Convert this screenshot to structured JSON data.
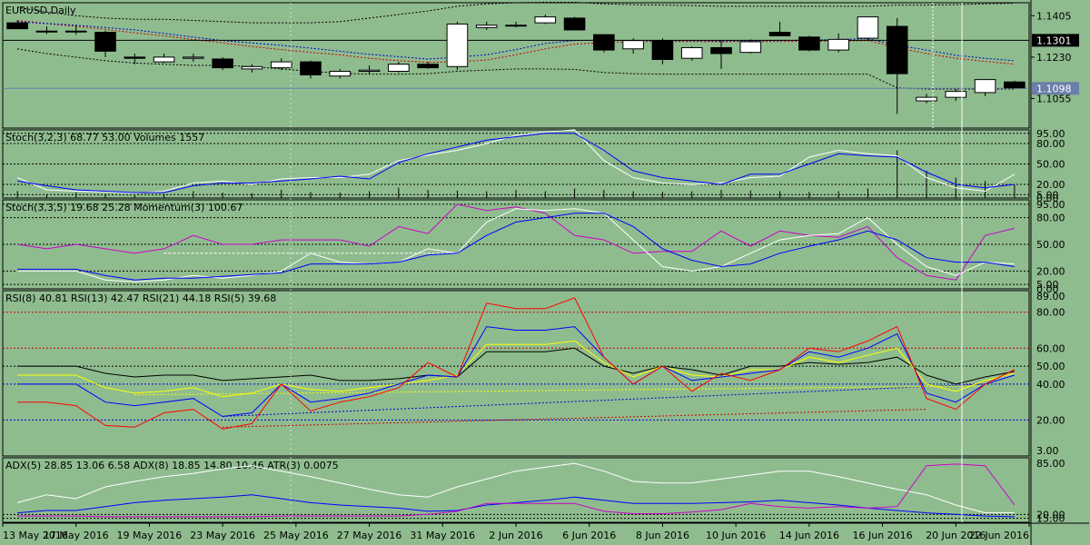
{
  "chart_data": [
    {
      "type": "candlestick",
      "title": "EURUSD,Daily",
      "price_labels": [
        "1.1405",
        "1.1230",
        "1.1055"
      ],
      "current_price": "1.1301",
      "bid_price": "1.1098",
      "ylim": [
        1.093,
        1.146
      ],
      "hline": 1.1301,
      "bidline": 1.1098,
      "candles": [
        {
          "o": 1.1375,
          "h": 1.1385,
          "l": 1.1355,
          "c": 1.135
        },
        {
          "o": 1.134,
          "h": 1.136,
          "l": 1.1328,
          "c": 1.134
        },
        {
          "o": 1.134,
          "h": 1.1365,
          "l": 1.1325,
          "c": 1.1338
        },
        {
          "o": 1.1335,
          "h": 1.1342,
          "l": 1.123,
          "c": 1.1255
        },
        {
          "o": 1.123,
          "h": 1.1245,
          "l": 1.12,
          "c": 1.1225
        },
        {
          "o": 1.121,
          "h": 1.1245,
          "l": 1.1205,
          "c": 1.123
        },
        {
          "o": 1.1225,
          "h": 1.1245,
          "l": 1.121,
          "c": 1.123
        },
        {
          "o": 1.1222,
          "h": 1.123,
          "l": 1.1175,
          "c": 1.1185
        },
        {
          "o": 1.118,
          "h": 1.12,
          "l": 1.1165,
          "c": 1.119
        },
        {
          "o": 1.1185,
          "h": 1.1225,
          "l": 1.1175,
          "c": 1.121
        },
        {
          "o": 1.121,
          "h": 1.1215,
          "l": 1.114,
          "c": 1.1155
        },
        {
          "o": 1.115,
          "h": 1.118,
          "l": 1.114,
          "c": 1.117
        },
        {
          "o": 1.117,
          "h": 1.1195,
          "l": 1.116,
          "c": 1.1175
        },
        {
          "o": 1.117,
          "h": 1.121,
          "l": 1.1165,
          "c": 1.12
        },
        {
          "o": 1.12,
          "h": 1.121,
          "l": 1.118,
          "c": 1.1185
        },
        {
          "o": 1.119,
          "h": 1.138,
          "l": 1.1175,
          "c": 1.137
        },
        {
          "o": 1.1355,
          "h": 1.138,
          "l": 1.1345,
          "c": 1.1365
        },
        {
          "o": 1.1365,
          "h": 1.138,
          "l": 1.1355,
          "c": 1.1365
        },
        {
          "o": 1.1375,
          "h": 1.141,
          "l": 1.137,
          "c": 1.14
        },
        {
          "o": 1.1395,
          "h": 1.14,
          "l": 1.1345,
          "c": 1.1345
        },
        {
          "o": 1.1325,
          "h": 1.1325,
          "l": 1.125,
          "c": 1.126
        },
        {
          "o": 1.1265,
          "h": 1.131,
          "l": 1.1245,
          "c": 1.13
        },
        {
          "o": 1.13,
          "h": 1.131,
          "l": 1.12,
          "c": 1.122
        },
        {
          "o": 1.1225,
          "h": 1.1275,
          "l": 1.1215,
          "c": 1.127
        },
        {
          "o": 1.127,
          "h": 1.13,
          "l": 1.118,
          "c": 1.1245
        },
        {
          "o": 1.125,
          "h": 1.1305,
          "l": 1.1245,
          "c": 1.1295
        },
        {
          "o": 1.1335,
          "h": 1.138,
          "l": 1.132,
          "c": 1.132
        },
        {
          "o": 1.1315,
          "h": 1.132,
          "l": 1.1255,
          "c": 1.126
        },
        {
          "o": 1.126,
          "h": 1.133,
          "l": 1.125,
          "c": 1.1305
        },
        {
          "o": 1.131,
          "h": 1.1395,
          "l": 1.13,
          "c": 1.14
        },
        {
          "o": 1.136,
          "h": 1.1395,
          "l": 1.099,
          "c": 1.116
        },
        {
          "o": 1.1045,
          "h": 1.1075,
          "l": 1.1035,
          "c": 1.106
        },
        {
          "o": 1.106,
          "h": 1.1095,
          "l": 1.1045,
          "c": 1.1085
        },
        {
          "o": 1.108,
          "h": 1.1135,
          "l": 1.1065,
          "c": 1.1135
        },
        {
          "o": 1.1125,
          "h": 1.113,
          "l": 1.11,
          "c": 1.11
        }
      ],
      "envelope_upper": [
        1.144,
        1.142,
        1.1405,
        1.1395,
        1.139,
        1.139,
        1.1385,
        1.138,
        1.1375,
        1.1375,
        1.1375,
        1.138,
        1.1395,
        1.141,
        1.1425,
        1.1445,
        1.1455,
        1.146,
        1.1462,
        1.1462,
        1.1455,
        1.1452,
        1.145,
        1.1448,
        1.1445,
        1.1445,
        1.1445,
        1.1445,
        1.1445,
        1.1445,
        1.145,
        1.145,
        1.1452,
        1.1455,
        1.1458
      ],
      "envelope_lower": [
        1.1265,
        1.1245,
        1.123,
        1.1215,
        1.1205,
        1.12,
        1.1195,
        1.1195,
        1.119,
        1.118,
        1.117,
        1.1162,
        1.1158,
        1.1158,
        1.116,
        1.117,
        1.1175,
        1.118,
        1.118,
        1.1178,
        1.1165,
        1.116,
        1.1158,
        1.1158,
        1.1158,
        1.1158,
        1.1158,
        1.1158,
        1.1158,
        1.1158,
        1.11,
        1.1095,
        1.1095,
        1.1095,
        1.1095
      ],
      "ma_fast": [
        1.138,
        1.1372,
        1.1365,
        1.1355,
        1.1345,
        1.133,
        1.1315,
        1.13,
        1.129,
        1.128,
        1.1268,
        1.1255,
        1.1242,
        1.1232,
        1.1222,
        1.123,
        1.124,
        1.1262,
        1.1288,
        1.13,
        1.1302,
        1.13,
        1.13,
        1.13,
        1.1298,
        1.13,
        1.13,
        1.1302,
        1.1305,
        1.1308,
        1.128,
        1.126,
        1.1238,
        1.1225,
        1.1215
      ],
      "ma_slow": [
        1.1385,
        1.1372,
        1.136,
        1.1347,
        1.1333,
        1.132,
        1.1305,
        1.129,
        1.1275,
        1.1262,
        1.125,
        1.124,
        1.1225,
        1.1215,
        1.1208,
        1.121,
        1.1218,
        1.124,
        1.1265,
        1.1285,
        1.1292,
        1.1295,
        1.1296,
        1.1296,
        1.1295,
        1.1296,
        1.1296,
        1.1297,
        1.1298,
        1.13,
        1.127,
        1.1245,
        1.1225,
        1.1212,
        1.12
      ],
      "colors": {
        "bull": "#ffffff",
        "bear": "#000000",
        "ma_fast": "#0000cc",
        "ma_slow": "#cc0000",
        "envelope": "#000000",
        "hline": "#000000",
        "bidline": "#6b7fa8"
      }
    },
    {
      "type": "line",
      "title": "Stoch(3,2,3) 68.77 53.00 Volumes 1557",
      "ylabels": [
        "95.00",
        "80.00",
        "50.00",
        "20.00",
        "5.00",
        "0.00"
      ],
      "ylim": [
        0,
        100
      ],
      "levels": [
        95,
        80,
        50,
        20,
        5
      ],
      "series": [
        {
          "color": "#ffffff",
          "values": [
            30,
            12,
            10,
            9,
            7,
            10,
            22,
            25,
            20,
            28,
            30,
            30,
            35,
            55,
            63,
            70,
            80,
            92,
            97,
            100,
            55,
            30,
            22,
            20,
            22,
            30,
            32,
            60,
            70,
            65,
            62,
            30,
            15,
            10,
            35,
            70
          ]
        },
        {
          "color": "#0000ff",
          "values": [
            25,
            18,
            12,
            10,
            8,
            8,
            18,
            22,
            22,
            25,
            28,
            32,
            28,
            52,
            65,
            75,
            85,
            90,
            95,
            95,
            70,
            40,
            30,
            25,
            20,
            35,
            35,
            50,
            65,
            62,
            60,
            38,
            20,
            15,
            20,
            53
          ]
        }
      ],
      "volume": [
        10,
        5,
        8,
        6,
        4,
        6,
        10,
        8,
        7,
        12,
        9,
        8,
        10,
        15,
        12,
        11,
        10,
        12,
        10,
        14,
        12,
        10,
        9,
        10,
        12,
        11,
        10,
        9,
        10,
        14,
        70,
        40,
        30,
        25,
        20
      ]
    },
    {
      "type": "line",
      "title": "Stoch(3,3,5) 19.68 25.28 Momentum(3) 100.67",
      "ylabels": [
        "95.00",
        "80.00",
        "50.00",
        "20.00",
        "5.00",
        "0.00"
      ],
      "ylim": [
        0,
        100
      ],
      "levels": [
        95,
        80,
        50,
        20,
        5
      ],
      "series": [
        {
          "color": "#cc00cc",
          "values": [
            50,
            45,
            50,
            45,
            40,
            45,
            60,
            50,
            50,
            55,
            55,
            55,
            48,
            70,
            62,
            95,
            88,
            92,
            85,
            60,
            55,
            40,
            42,
            42,
            65,
            48,
            65,
            60,
            58,
            70,
            35,
            15,
            10,
            60,
            68
          ]
        },
        {
          "color": "#ffffff",
          "values": [
            20,
            20,
            20,
            10,
            8,
            10,
            15,
            12,
            15,
            20,
            40,
            30,
            28,
            30,
            45,
            40,
            75,
            90,
            88,
            90,
            85,
            55,
            25,
            20,
            25,
            40,
            55,
            60,
            62,
            80,
            50,
            25,
            15,
            30,
            28
          ]
        },
        {
          "color": "#0000ff",
          "values": [
            22,
            22,
            22,
            15,
            10,
            12,
            12,
            14,
            16,
            18,
            28,
            28,
            28,
            30,
            38,
            40,
            60,
            75,
            80,
            85,
            85,
            70,
            45,
            32,
            25,
            28,
            40,
            48,
            55,
            65,
            55,
            35,
            30,
            30,
            25
          ]
        }
      ],
      "dashed_white": {
        "x0": 5,
        "x1": 15,
        "y": 40
      }
    },
    {
      "type": "line",
      "title": "RSI(8) 40.81 RSI(13) 42.47 RSI(21) 44.18 RSI(5) 39.68",
      "ylabels": [
        "89.00",
        "80.00",
        "60.00",
        "50.00",
        "40.00",
        "20.00",
        "3.00"
      ],
      "ylim": [
        0,
        92
      ],
      "levels": [
        80,
        60,
        50,
        40,
        20
      ],
      "series": [
        {
          "color": "#000000",
          "values": [
            50,
            50,
            50,
            46,
            44,
            45,
            45,
            42,
            43,
            44,
            45,
            42,
            42,
            43,
            45,
            44,
            58,
            58,
            58,
            60,
            50,
            46,
            50,
            48,
            45,
            50,
            50,
            52,
            51,
            52,
            55,
            45,
            40,
            44,
            47,
            44
          ]
        },
        {
          "color": "#ffff00",
          "values": [
            45,
            45,
            45,
            38,
            35,
            36,
            38,
            33,
            35,
            40,
            37,
            36,
            38,
            40,
            42,
            45,
            62,
            62,
            62,
            64,
            52,
            44,
            50,
            45,
            44,
            48,
            48,
            55,
            52,
            56,
            60,
            40,
            36,
            42,
            46,
            42
          ]
        },
        {
          "color": "#0000ff",
          "values": [
            40,
            40,
            40,
            30,
            28,
            30,
            32,
            22,
            24,
            40,
            30,
            32,
            35,
            40,
            45,
            44,
            72,
            70,
            70,
            72,
            55,
            40,
            50,
            42,
            44,
            46,
            48,
            58,
            55,
            60,
            68,
            35,
            30,
            40,
            45,
            42
          ]
        },
        {
          "color": "#ff0000",
          "values": [
            30,
            30,
            28,
            17,
            16,
            24,
            26,
            15,
            18,
            40,
            25,
            30,
            33,
            38,
            52,
            44,
            85,
            82,
            82,
            88,
            55,
            40,
            50,
            36,
            46,
            42,
            48,
            60,
            58,
            64,
            72,
            32,
            26,
            40,
            48,
            40
          ]
        }
      ],
      "trend_blue": {
        "x0": 7,
        "y0": 22,
        "x1": 33,
        "y1": 40
      },
      "trend_red": {
        "x0": 7,
        "y0": 16,
        "x1": 31,
        "y1": 26
      },
      "trend_yellow": {
        "x0": 4,
        "y0": 34,
        "x1": 33,
        "y1": 39
      }
    },
    {
      "type": "line",
      "title": "ADX(5) 28.85 13.06 6.58 ADX(8) 18.85 14.80 10.46 ATR(3) 0.0075",
      "ylabels": [
        "85.00",
        "20.00",
        "15.00"
      ],
      "ylim": [
        10,
        92
      ],
      "series": [
        {
          "color": "#ffffff",
          "values": [
            35,
            45,
            40,
            55,
            62,
            68,
            72,
            78,
            82,
            75,
            68,
            60,
            52,
            45,
            42,
            55,
            65,
            75,
            80,
            85,
            75,
            62,
            60,
            60,
            65,
            70,
            75,
            75,
            68,
            60,
            52,
            45,
            32,
            22,
            22
          ]
        },
        {
          "color": "#0000ff",
          "values": [
            22,
            25,
            25,
            30,
            35,
            38,
            40,
            42,
            45,
            40,
            35,
            32,
            30,
            28,
            24,
            25,
            32,
            35,
            38,
            42,
            38,
            34,
            34,
            34,
            35,
            36,
            38,
            35,
            32,
            28,
            25,
            22,
            20,
            18,
            17
          ]
        },
        {
          "color": "#cc00cc",
          "values": [
            18,
            18,
            18,
            17,
            17,
            17,
            17,
            17,
            17,
            18,
            18,
            18,
            18,
            18,
            20,
            24,
            34,
            34,
            34,
            34,
            24,
            21,
            21,
            23,
            26,
            34,
            30,
            28,
            30,
            28,
            30,
            82,
            84,
            82,
            32,
            25
          ]
        }
      ]
    }
  ],
  "x_axis_labels": [
    "13 May 2016",
    "17 May 2016",
    "19 May 2016",
    "23 May 2016",
    "25 May 2016",
    "27 May 2016",
    "31 May 2016",
    "2 Jun 2016",
    "6 Jun 2016",
    "8 Jun 2016",
    "10 Jun 2016",
    "14 Jun 2016",
    "16 Jun 2016",
    "20 Jun 2016",
    "22 Jun 2016"
  ],
  "colors": {
    "background": "#8fbc8f",
    "grid": "#000000",
    "border": "#000000"
  }
}
